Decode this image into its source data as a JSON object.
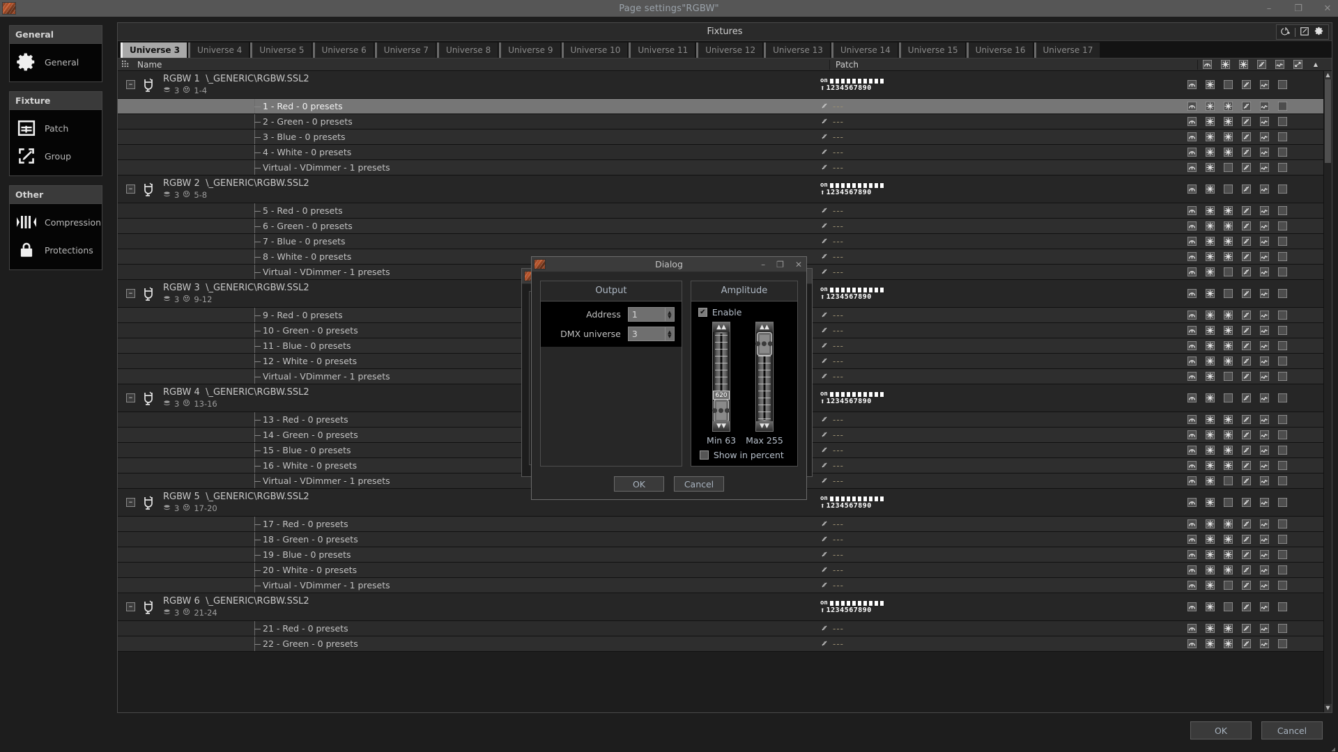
{
  "window": {
    "title": "Page settings\"RGBW\"",
    "controls": {
      "minimize": "–",
      "restore": "❐",
      "close": "✕"
    }
  },
  "sidebar": {
    "groups": [
      {
        "title": "General",
        "items": [
          {
            "label": "General",
            "icon": "gear-icon"
          }
        ]
      },
      {
        "title": "Fixture",
        "items": [
          {
            "label": "Patch",
            "icon": "table-icon"
          },
          {
            "label": "Group",
            "icon": "group-edit-icon"
          }
        ]
      },
      {
        "title": "Other",
        "items": [
          {
            "label": "Compression",
            "icon": "compression-icon"
          },
          {
            "label": "Protections",
            "icon": "lock-icon"
          }
        ]
      }
    ]
  },
  "panel": {
    "title": "Fixtures",
    "tools": [
      "power-add-icon",
      "separator",
      "edit-square-icon",
      "gear-icon"
    ]
  },
  "tabs": {
    "active_index": 0,
    "items": [
      "Universe 3",
      "Universe 4",
      "Universe 5",
      "Universe 6",
      "Universe 7",
      "Universe 8",
      "Universe 9",
      "Universe 10",
      "Universe 11",
      "Universe 12",
      "Universe 13",
      "Universe 14",
      "Universe 15",
      "Universe 16",
      "Universe 17"
    ]
  },
  "table": {
    "headers": {
      "name": "Name",
      "patch": "Patch"
    },
    "header_icons": [
      "dimmer-icon",
      "intensity-icon",
      "intensity2-icon",
      "fade-icon",
      "wave-icon",
      "resize-icon"
    ],
    "patch_on_label": "on",
    "patch_numbers": "1234567890",
    "patch_empty": "---",
    "fixtures": [
      {
        "name": "RGBW  1",
        "profile": "\\_GENERIC\\RGBW.SSL2",
        "universe": "3",
        "address": "1-4",
        "channels": [
          {
            "label": "1 - Red - 0 presets",
            "selected": true
          },
          {
            "label": "2 - Green - 0 presets",
            "selected": false
          },
          {
            "label": "3 - Blue - 0 presets",
            "selected": false
          },
          {
            "label": "4 - White - 0 presets",
            "selected": false
          },
          {
            "label": "Virtual - VDimmer - 1 presets",
            "selected": false
          }
        ]
      },
      {
        "name": "RGBW  2",
        "profile": "\\_GENERIC\\RGBW.SSL2",
        "universe": "3",
        "address": "5-8",
        "channels": [
          {
            "label": "5 - Red - 0 presets",
            "selected": false
          },
          {
            "label": "6 - Green - 0 presets",
            "selected": false
          },
          {
            "label": "7 - Blue - 0 presets",
            "selected": false
          },
          {
            "label": "8 - White - 0 presets",
            "selected": false
          },
          {
            "label": "Virtual - VDimmer - 1 presets",
            "selected": false
          }
        ]
      },
      {
        "name": "RGBW  3",
        "profile": "\\_GENERIC\\RGBW.SSL2",
        "universe": "3",
        "address": "9-12",
        "channels": [
          {
            "label": "9 - Red - 0 presets",
            "selected": false
          },
          {
            "label": "10 - Green - 0 presets",
            "selected": false
          },
          {
            "label": "11 - Blue - 0 presets",
            "selected": false
          },
          {
            "label": "12 - White - 0 presets",
            "selected": false
          },
          {
            "label": "Virtual - VDimmer - 1 presets",
            "selected": false
          }
        ]
      },
      {
        "name": "RGBW  4",
        "profile": "\\_GENERIC\\RGBW.SSL2",
        "universe": "3",
        "address": "13-16",
        "channels": [
          {
            "label": "13 - Red - 0 presets",
            "selected": false
          },
          {
            "label": "14 - Green - 0 presets",
            "selected": false
          },
          {
            "label": "15 - Blue - 0 presets",
            "selected": false
          },
          {
            "label": "16 - White - 0 presets",
            "selected": false
          },
          {
            "label": "Virtual - VDimmer - 1 presets",
            "selected": false
          }
        ]
      },
      {
        "name": "RGBW  5",
        "profile": "\\_GENERIC\\RGBW.SSL2",
        "universe": "3",
        "address": "17-20",
        "channels": [
          {
            "label": "17 - Red - 0 presets",
            "selected": false
          },
          {
            "label": "18 - Green - 0 presets",
            "selected": false
          },
          {
            "label": "19 - Blue - 0 presets",
            "selected": false
          },
          {
            "label": "20 - White - 0 presets",
            "selected": false
          },
          {
            "label": "Virtual - VDimmer - 1 presets",
            "selected": false
          }
        ]
      },
      {
        "name": "RGBW  6",
        "profile": "\\_GENERIC\\RGBW.SSL2",
        "universe": "3",
        "address": "21-24",
        "channels": [
          {
            "label": "21 - Red - 0 presets",
            "selected": false
          },
          {
            "label": "22 - Green - 0 presets",
            "selected": false
          }
        ]
      }
    ]
  },
  "dialog": {
    "title": "Dialog",
    "controls": {
      "minimize": "–",
      "restore": "❐",
      "close": "✕"
    },
    "output": {
      "title": "Output",
      "address_label": "Address",
      "address_value": "1",
      "universe_label": "DMX universe",
      "universe_value": "3"
    },
    "amplitude": {
      "title": "Amplitude",
      "enable_label": "Enable",
      "enable_checked": true,
      "min_label": "Min 63",
      "max_label": "Max 255",
      "min_value": 63,
      "max_value": 255,
      "tooltip_value": "620",
      "percent_label": "Show in percent",
      "percent_checked": false
    },
    "buttons": {
      "ok": "OK",
      "cancel": "Cancel"
    }
  },
  "footer": {
    "ok": "OK",
    "cancel": "Cancel"
  }
}
